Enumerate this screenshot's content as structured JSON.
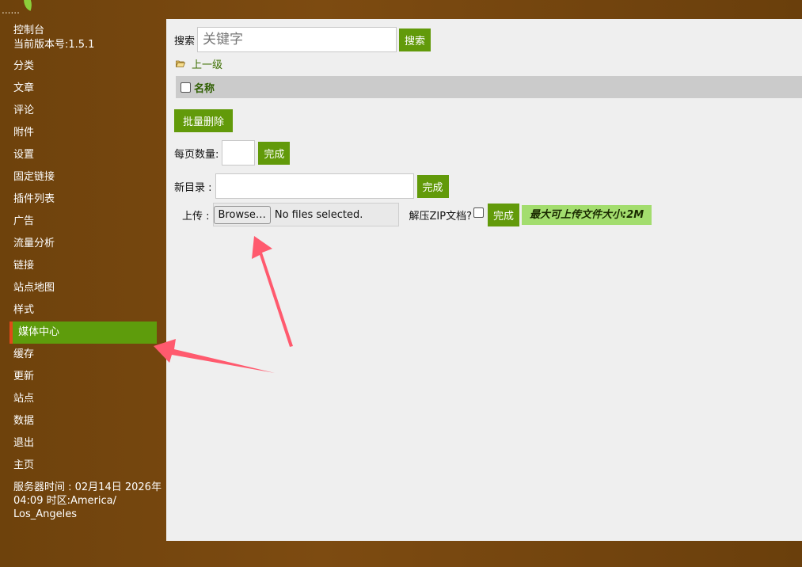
{
  "header": {
    "dots": "......"
  },
  "sidebar": {
    "console_label": "控制台",
    "version_label": "当前版本号:1.5.1",
    "items": [
      {
        "label": "分类"
      },
      {
        "label": "文章"
      },
      {
        "label": "评论"
      },
      {
        "label": "附件"
      },
      {
        "label": "设置"
      },
      {
        "label": "固定链接"
      },
      {
        "label": "插件列表"
      },
      {
        "label": "广告"
      },
      {
        "label": "流量分析"
      },
      {
        "label": "链接"
      },
      {
        "label": "站点地图"
      },
      {
        "label": "样式"
      },
      {
        "label": "媒体中心",
        "active": true
      },
      {
        "label": "缓存"
      },
      {
        "label": "更新"
      },
      {
        "label": "站点"
      },
      {
        "label": "数据"
      },
      {
        "label": "退出"
      },
      {
        "label": "主页"
      }
    ],
    "server_time_line1": "服务器时间 : 02月14日 2026年",
    "server_time_line2": "04:09 时区:America/",
    "server_time_line3": "Los_Angeles"
  },
  "search": {
    "label": "搜索",
    "placeholder": "关键字",
    "button": "搜索"
  },
  "nav": {
    "up_label": "上一级"
  },
  "table": {
    "columns": [
      "名称"
    ]
  },
  "actions": {
    "batch_delete": "批量删除"
  },
  "per_page": {
    "label": "每页数量:",
    "value": "",
    "button": "完成"
  },
  "new_dir": {
    "label": "新目录 :",
    "value": "",
    "button": "完成"
  },
  "upload": {
    "label": "上传 :",
    "browse_button": "Browse…",
    "file_status": "No files selected.",
    "unzip_label": "解压ZIP文档?",
    "button": "完成",
    "max_size": "最大可上传文件大小:2M"
  },
  "colors": {
    "sidebar_bg": "#7a4a10",
    "accent_green": "#629a0a",
    "active_marker": "#e0491a",
    "annotation_arrow": "#ff5a6e"
  },
  "icons": {
    "folder": "folder-open-icon",
    "arrow": "annotation-arrow"
  }
}
